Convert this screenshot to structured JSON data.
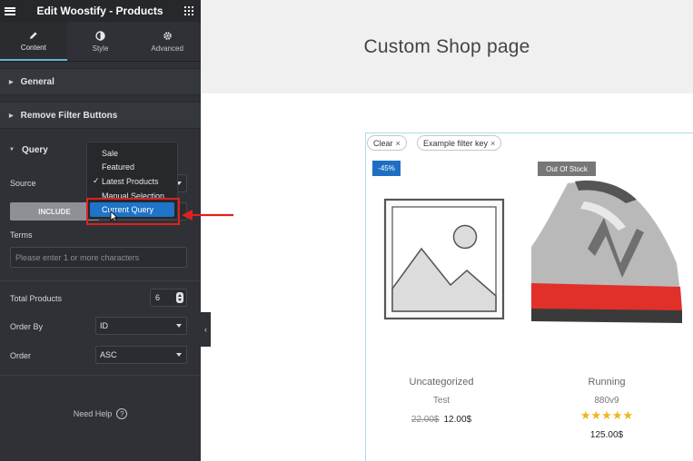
{
  "panel": {
    "title": "Edit Woostify - Products",
    "tabs": [
      {
        "label": "Content",
        "icon": "pencil-icon"
      },
      {
        "label": "Style",
        "icon": "contrast-icon"
      },
      {
        "label": "Advanced",
        "icon": "gear-icon"
      }
    ],
    "sections": {
      "general": "General",
      "remove_filter": "Remove Filter Buttons",
      "query": "Query"
    },
    "source_label": "Source",
    "include_label": "INCLUDE",
    "terms_label": "Terms",
    "terms_placeholder": "Please enter 1 or more characters",
    "total_label": "Total Products",
    "total_value": "6",
    "orderby_label": "Order By",
    "orderby_value": "ID",
    "order_label": "Order",
    "order_value": "ASC",
    "help_label": "Need Help",
    "help_icon": "?",
    "collapse_icon": "‹"
  },
  "dropdown": {
    "options": [
      "Sale",
      "Featured",
      "Latest Products",
      "Manual Selection",
      "Current Query"
    ],
    "checked": "Latest Products",
    "selected": "Current Query",
    "check_glyph": "✓"
  },
  "preview": {
    "title": "Custom Shop page",
    "filters": [
      {
        "label": "Clear",
        "close": "×"
      },
      {
        "label": "Example filter key",
        "close": "×"
      }
    ],
    "products": [
      {
        "badge": "-45%",
        "category": "Uncategorized",
        "name": "Test",
        "old_price": "22.00$",
        "price": "12.00$"
      },
      {
        "badge": "Out Of Stock",
        "category": "Running",
        "name": "880v9",
        "rating": "★★★★★",
        "price": "125.00$"
      }
    ]
  },
  "colors": {
    "panel_bg": "#2f3136",
    "accent": "#64b5d8",
    "selection_blue": "#1f73c8",
    "highlight_red": "#e02020",
    "star": "#f0b41c"
  }
}
